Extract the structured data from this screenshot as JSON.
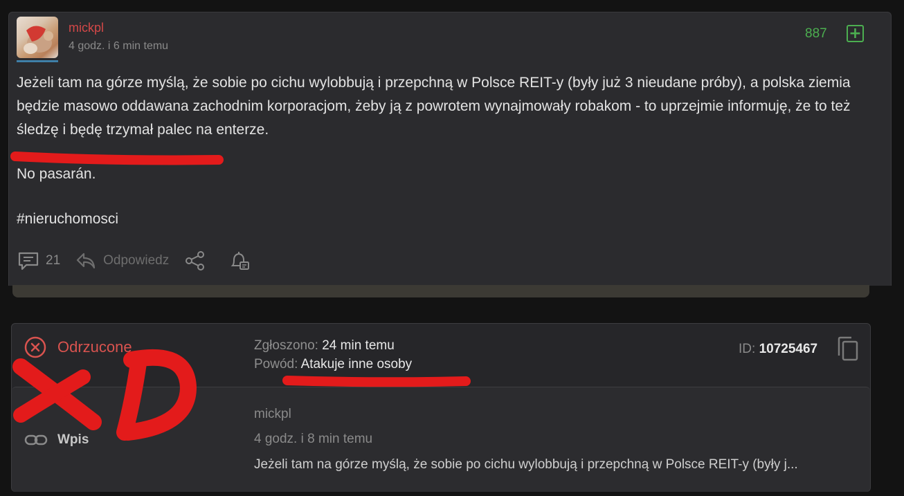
{
  "post": {
    "author": "mickpl",
    "time": "4 godz. i 6 min temu",
    "votes": "887",
    "plus_symbol": "+",
    "body_p1": "Jeżeli tam na górze myślą, że sobie po cichu wylobbują i przepchną w Polsce REIT-y (były już 3 nieudane próby), a polska ziemia będzie masowo oddawana zachodnim korporacjom, żeby ją z powrotem wynajmowały robakom - to uprzejmie informuję, że to też śledzę i będę trzymał palec na enterze.",
    "body_p2": "No pasarán.",
    "tag": "#nieruchomosci",
    "comments_count": "21",
    "reply_label": "Odpowiedz"
  },
  "report": {
    "status": "Odrzucone",
    "reported_label": "Zgłoszono:",
    "reported_value": "24 min temu",
    "reason_label": "Powód:",
    "reason_value": "Atakuje inne osoby",
    "id_label": "ID:",
    "id_value": "10725467",
    "type_label": "Wpis",
    "inner_author": "mickpl",
    "inner_time": "4 godz. i 8 min temu",
    "inner_excerpt": "Jeżeli tam na górze myślą, że sobie po cichu wylobbują i przepchną w Polsce REIT-y (były j..."
  },
  "colors": {
    "background": "#131313",
    "card": "#2b2b2e",
    "author_red": "#d34848",
    "vote_green": "#4caf50",
    "rejected_red": "#d9534f",
    "marker_red": "#e31b1b"
  },
  "icons": [
    "comment-icon",
    "reply-icon",
    "share-icon",
    "notification-icon",
    "rejected-status-icon",
    "copy-icon",
    "link-icon",
    "plus-icon"
  ]
}
